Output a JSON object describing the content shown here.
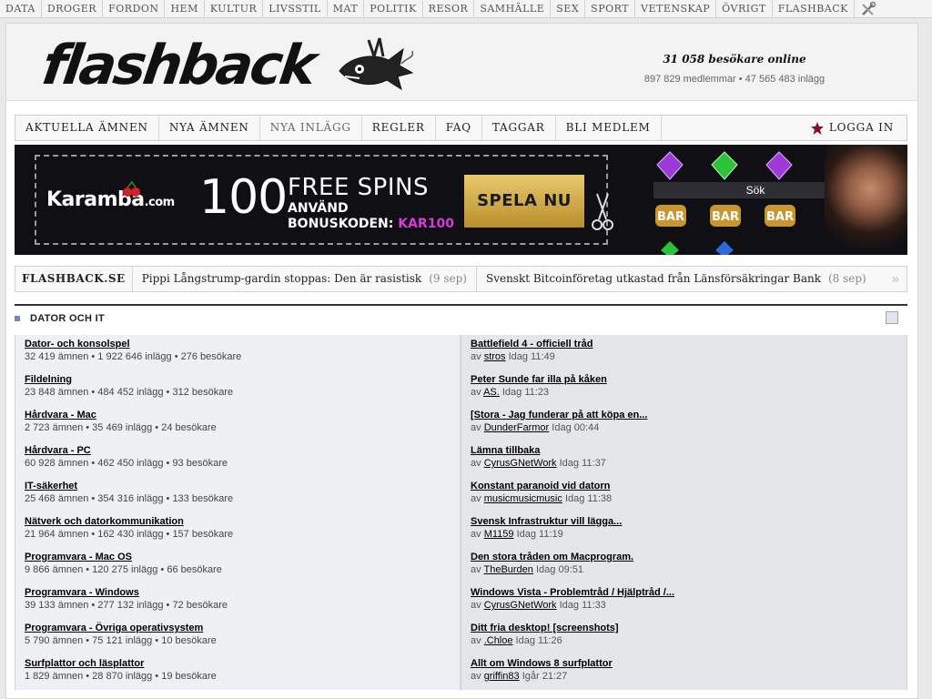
{
  "topbar": {
    "categories": [
      "DATA",
      "DROGER",
      "FORDON",
      "HEM",
      "KULTUR",
      "LIVSSTIL",
      "MAT",
      "POLITIK",
      "RESOR",
      "SAMHÄLLE",
      "SEX",
      "SPORT",
      "VETENSKAP",
      "ÖVRIGT",
      "FLASHBACK"
    ],
    "tools_icon": "tools-icon"
  },
  "header": {
    "logo": "flashback",
    "online": "31 058 besökare online",
    "stats": "897 829 medlemmar • 47 565 483 inlägg"
  },
  "nav": {
    "items": [
      "AKTUELLA ÄMNEN",
      "NYA ÄMNEN",
      "NYA INLÄGG",
      "REGLER",
      "FAQ",
      "TAGGAR",
      "BLI MEDLEM"
    ],
    "active": "NYA INLÄGG",
    "login": "LOGGA IN",
    "login_icon": "star-icon"
  },
  "banner": {
    "brand": "Karamba",
    "brand_suffix": ".com",
    "big_number": "100",
    "free_spins": "FREE SPINS",
    "use_line1": "ANVÄND",
    "use_line2": "BONUSKODEN:",
    "code": "KAR100",
    "cta": "SPELA NU",
    "search_overlay": "Sök",
    "bar_labels": [
      "BAR",
      "BAR",
      "BAR"
    ]
  },
  "ticker": {
    "label": "FLASHBACK.SE",
    "items": [
      {
        "text": "Pippi Långstrump-gardin stoppas: Den är rasistisk",
        "date": "(9 sep)"
      },
      {
        "text": "Svenskt Bitcoinföretag utkastad från Länsförsäkringar Bank",
        "date": "(8 sep)"
      }
    ],
    "next_icon": "double-chevron-right-icon"
  },
  "section": {
    "title": "DATOR OCH IT"
  },
  "forums": [
    {
      "name": "Dator- och konsolspel",
      "stats": "32 419 ämnen • 1 922 646 inlägg • 276 besökare",
      "thread": "Battlefield 4 - officiell tråd",
      "by": "av",
      "user": "stros",
      "time": "Idag 11:49"
    },
    {
      "name": "Fildelning",
      "stats": "23 848 ämnen • 484 452 inlägg • 312 besökare",
      "thread": "Peter Sunde far illa på kåken",
      "by": "av",
      "user": "AS.",
      "time": "Idag 11:23"
    },
    {
      "name": "Hårdvara - Mac",
      "stats": "2 723 ämnen • 35 469 inlägg • 24 besökare",
      "thread": "[Stora - Jag funderar på att köpa en...",
      "by": "av",
      "user": "DunderFarmor",
      "time": "Idag 00:44"
    },
    {
      "name": "Hårdvara - PC",
      "stats": "60 928 ämnen • 462 450 inlägg • 93 besökare",
      "thread": "Lämna tillbaka",
      "by": "av",
      "user": "CyrusGNetWork",
      "time": "Idag 11:37"
    },
    {
      "name": "IT-säkerhet",
      "stats": "25 468 ämnen • 354 316 inlägg • 133 besökare",
      "thread": "Konstant paranoid vid datorn",
      "by": "av",
      "user": "musicmusicmusic",
      "time": "Idag 11:38"
    },
    {
      "name": "Nätverk och datorkommunikation",
      "stats": "21 964 ämnen • 162 430 inlägg • 157 besökare",
      "thread": "Svensk Infrastruktur vill lägga...",
      "by": "av",
      "user": "M1159",
      "time": "Idag 11:19"
    },
    {
      "name": "Programvara - Mac OS",
      "stats": "9 866 ämnen • 120 275 inlägg • 66 besökare",
      "thread": "Den stora tråden om Macprogram.",
      "by": "av",
      "user": "TheBurden",
      "time": "Idag 09:51"
    },
    {
      "name": "Programvara - Windows",
      "stats": "39 133 ämnen • 277 132 inlägg • 72 besökare",
      "thread": "Windows Vista - Problemtråd / Hjälptråd /...",
      "by": "av",
      "user": "CyrusGNetWork",
      "time": "Idag 11:33"
    },
    {
      "name": "Programvara - Övriga operativsystem",
      "stats": "5 790 ämnen • 75 121 inlägg • 10 besökare",
      "thread": "Ditt fria desktop! [screenshots]",
      "by": "av",
      "user": ".Chloe",
      "time": "Idag 11:26"
    },
    {
      "name": "Surfplattor och läsplattor",
      "stats": "1 829 ämnen • 28 870 inlägg • 19 besökare",
      "thread": "Allt om Windows 8 surfplattor",
      "by": "av",
      "user": "griffin83",
      "time": "Igår 21:27"
    }
  ]
}
